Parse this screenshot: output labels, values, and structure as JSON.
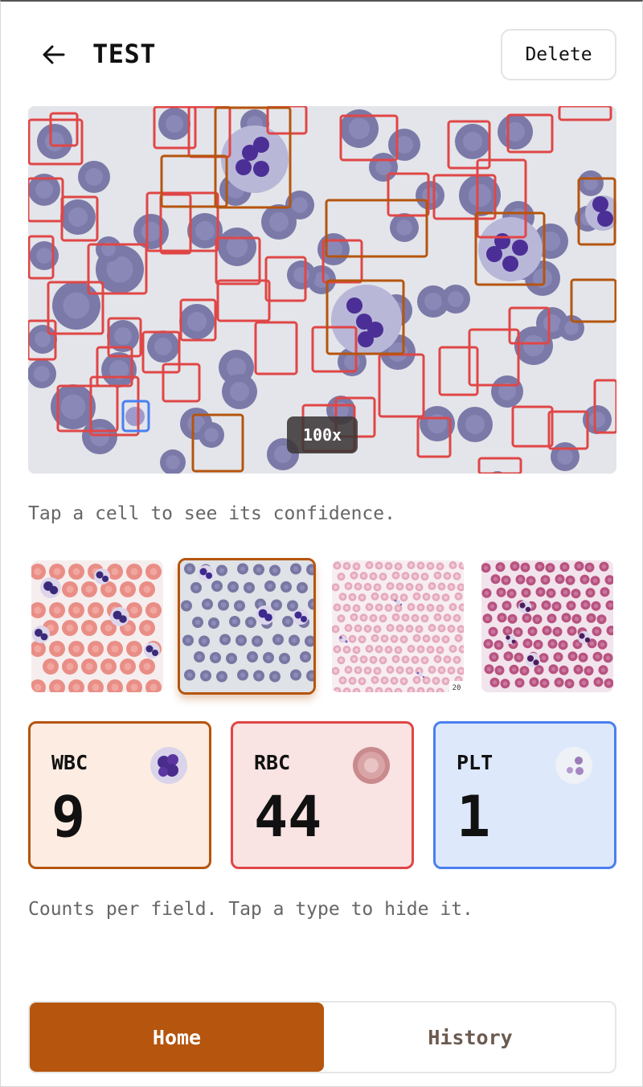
{
  "header": {
    "title": "TEST",
    "delete_label": "Delete",
    "back_icon": "arrow-left-icon"
  },
  "viewer": {
    "magnification": "100x",
    "box_colors": {
      "wbc": "#b5550e",
      "rbc": "#e04646",
      "plt": "#4a7ff0"
    }
  },
  "hint": "Tap a cell to see its confidence.",
  "thumbnails": [
    {
      "name": "pink-smear",
      "selected": false
    },
    {
      "name": "gray-smear",
      "selected": true
    },
    {
      "name": "pale-smear",
      "selected": false,
      "corner_label": "20"
    },
    {
      "name": "magenta-smear",
      "selected": false
    }
  ],
  "counts": [
    {
      "type": "WBC",
      "value": "9",
      "color": "#b5550e",
      "icon": "wbc-cell-icon"
    },
    {
      "type": "RBC",
      "value": "44",
      "color": "#e04646",
      "icon": "rbc-cell-icon"
    },
    {
      "type": "PLT",
      "value": "1",
      "color": "#4a7ff0",
      "icon": "platelet-cell-icon"
    }
  ],
  "counts_note": "Counts per field. Tap a type to hide it.",
  "tabs": {
    "home": "Home",
    "history": "History",
    "active": "Home"
  }
}
